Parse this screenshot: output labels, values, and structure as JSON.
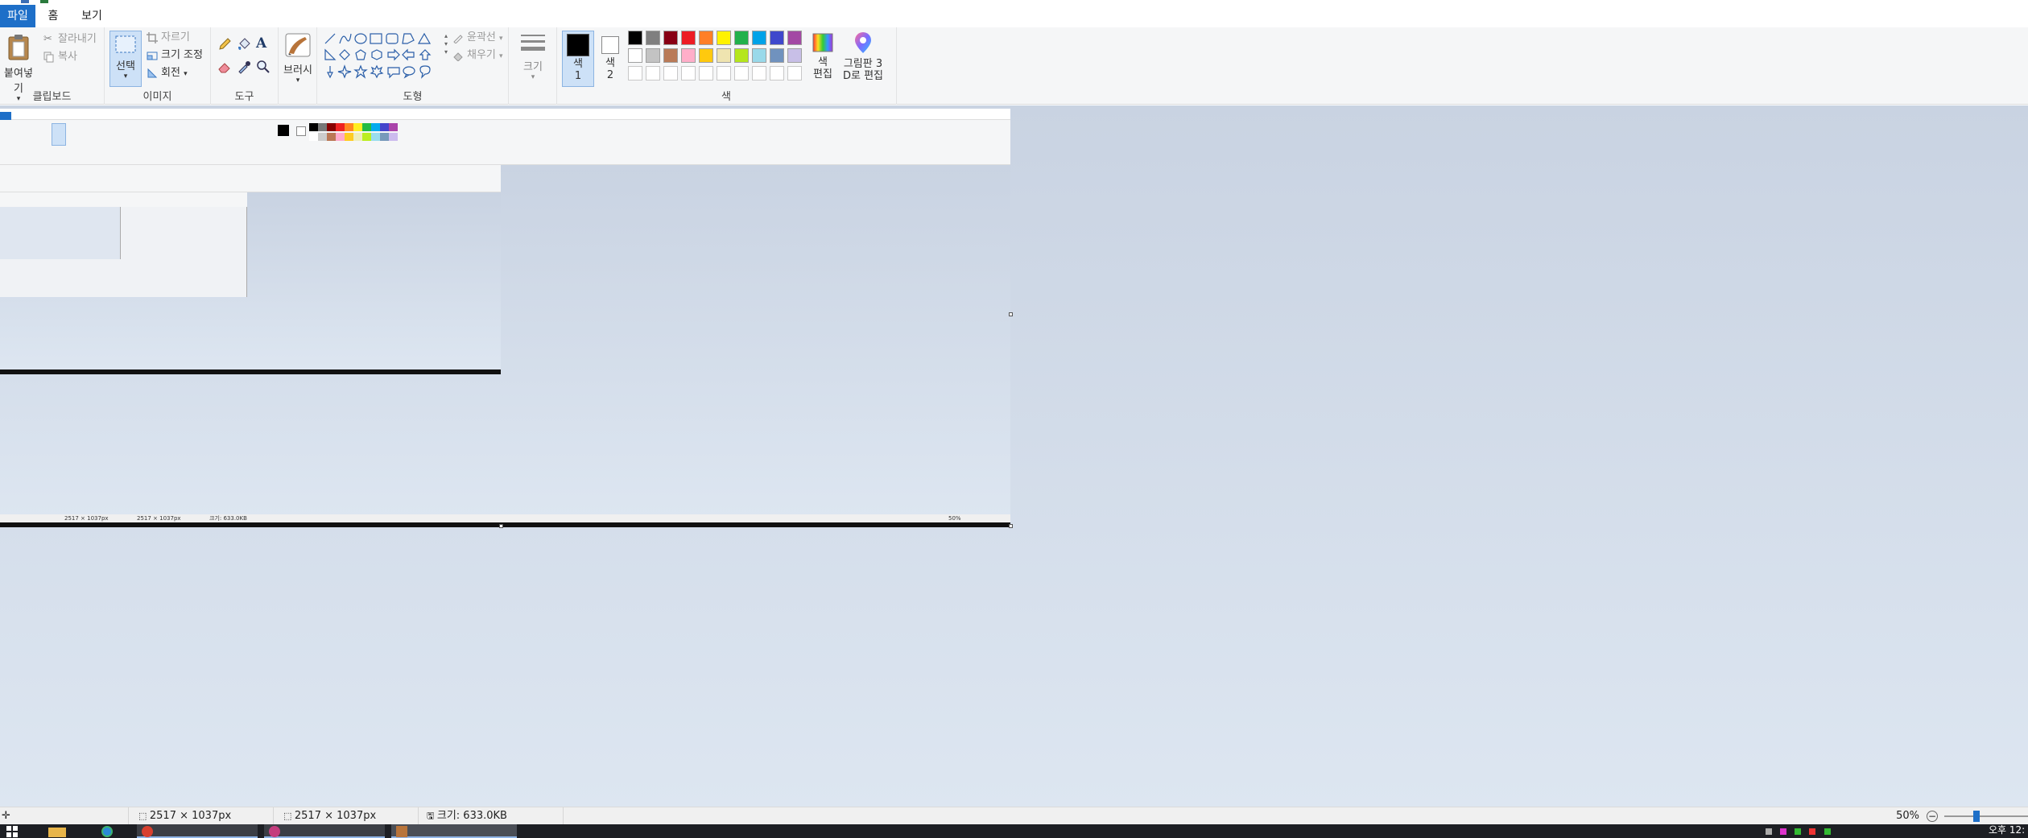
{
  "menu": {
    "tabs": [
      {
        "label": "파일"
      },
      {
        "label": "홈"
      },
      {
        "label": "보기"
      }
    ]
  },
  "ribbon": {
    "clipboard": {
      "group_label": "클립보드",
      "paste_label": "붙여넣기",
      "cut_label": "잘라내기",
      "copy_label": "복사"
    },
    "image": {
      "group_label": "이미지",
      "select_label": "선택",
      "crop_label": "자르기",
      "resize_label": "크기 조정",
      "rotate_label": "회전"
    },
    "tools": {
      "group_label": "도구"
    },
    "brushes": {
      "label": "브러시"
    },
    "shapes": {
      "group_label": "도형",
      "outline_label": "윤곽선",
      "fill_label": "채우기"
    },
    "size": {
      "label": "크기"
    },
    "colors": {
      "group_label": "색",
      "color1_label": "색\n1",
      "color2_label": "색\n2",
      "edit_colors_label": "색\n편집",
      "paint3d_label": "그림판 3\nD로 편집",
      "palette_row1": [
        "#000000",
        "#7f7f7f",
        "#880015",
        "#ed1c24",
        "#ff7f27",
        "#fff200",
        "#22b14c",
        "#00a2e8",
        "#3f48cc",
        "#a349a4"
      ],
      "palette_row2": [
        "#ffffff",
        "#c3c3c3",
        "#b97a57",
        "#ffaec9",
        "#ffc90e",
        "#efe4b0",
        "#b5e61d",
        "#99d9ea",
        "#7092be",
        "#c8bfe7"
      ]
    }
  },
  "nested": {
    "status_1": "2517 × 1037px",
    "status_2": "2517 × 1037px",
    "status_3": "크기: 633.0KB",
    "zoom": "50%"
  },
  "statusbar": {
    "cursor_pos": "",
    "selection_size": "2517 × 1037px",
    "image_size": "2517 × 1037px",
    "file_size": "크기: 633.0KB",
    "zoom": "50%"
  },
  "taskbar": {
    "clock": "오후 12:"
  }
}
